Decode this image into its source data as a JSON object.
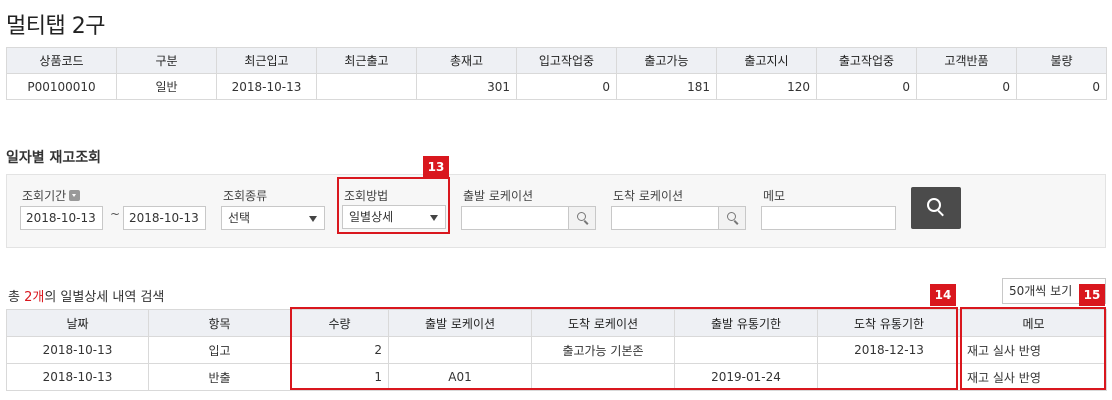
{
  "page": {
    "title": "멀티탭 2구"
  },
  "summary": {
    "headers": [
      "상품코드",
      "구분",
      "최근입고",
      "최근출고",
      "총재고",
      "입고작업중",
      "출고가능",
      "출고지시",
      "출고작업중",
      "고객반품",
      "불량"
    ],
    "row": [
      "P00100010",
      "일반",
      "2018-10-13",
      "",
      "301",
      "0",
      "181",
      "120",
      "0",
      "0",
      "0"
    ]
  },
  "search": {
    "section_title": "일자별 재고조회",
    "period_label": "조회기간",
    "date_from": "2018-10-13",
    "date_tilde": "~",
    "date_to": "2018-10-13",
    "type_label": "조회종류",
    "type_value": "선택",
    "method_label": "조회방법",
    "method_value": "일별상세",
    "from_location_label": "출발 로케이션",
    "from_location_value": "",
    "to_location_label": "도착 로케이션",
    "to_location_value": "",
    "memo_label": "메모",
    "memo_value": ""
  },
  "results": {
    "count_prefix": "총 ",
    "count_value": "2개",
    "count_suffix": "의 일별상세 내역 검색",
    "page_size": "50개씩 보기",
    "headers": [
      "날짜",
      "항목",
      "수량",
      "출발 로케이션",
      "도착 로케이션",
      "출발 유통기한",
      "도착 유통기한",
      "메모"
    ],
    "rows": [
      [
        "2018-10-13",
        "입고",
        "2",
        "",
        "출고가능 기본존",
        "",
        "2018-12-13",
        "재고 실사 반영"
      ],
      [
        "2018-10-13",
        "반출",
        "1",
        "A01",
        "",
        "2019-01-24",
        "",
        "재고 실사 반영"
      ]
    ]
  },
  "callouts": [
    "13",
    "14",
    "15"
  ],
  "colors": {
    "accent_red": "#d9171e",
    "header_bg": "#eef0f4",
    "search_button": "#4b4b4b"
  },
  "icons": [
    "info-icon",
    "chevron-down-icon",
    "search-icon"
  ]
}
